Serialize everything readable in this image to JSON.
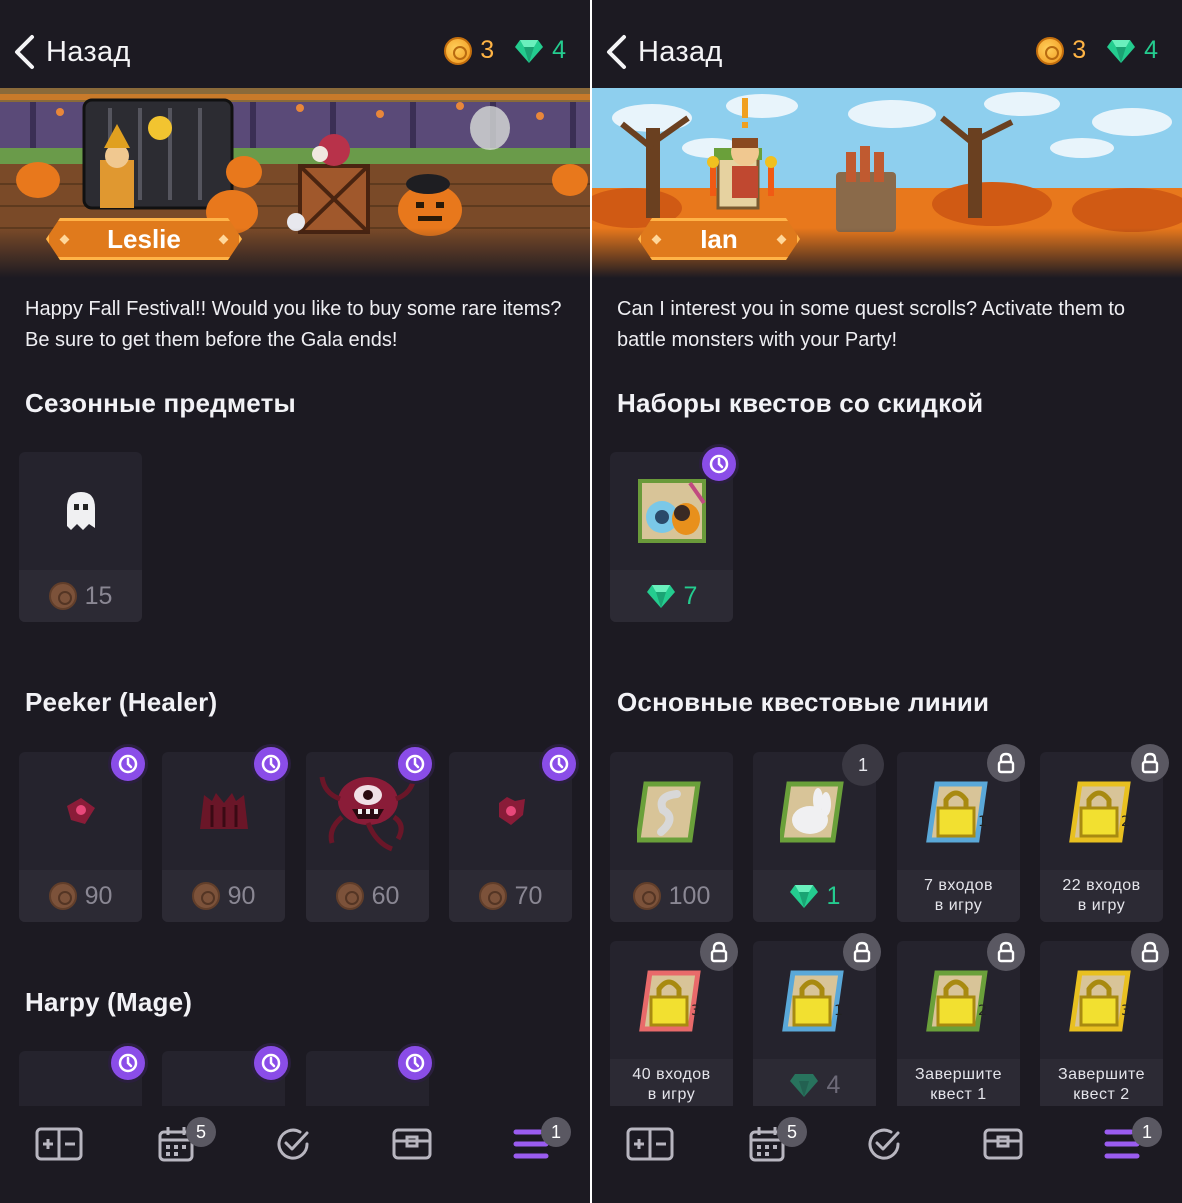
{
  "left": {
    "header": {
      "back_label": "Назад",
      "gold": "3",
      "gems": "4"
    },
    "banner": {
      "npc_name": "Leslie"
    },
    "intro": "Happy Fall Festival!! Would you like to buy some rare items? Be sure to get them before the Gala ends!",
    "sections": [
      {
        "title": "Сезонные предметы",
        "items": [
          {
            "icon": "ghost-icon",
            "price": "15",
            "currency": "gold",
            "timed": false
          }
        ]
      },
      {
        "title": "Peeker (Healer)",
        "items": [
          {
            "icon": "peeker-eye-icon",
            "price": "90",
            "currency": "gold",
            "timed": true
          },
          {
            "icon": "peeker-armor-icon",
            "price": "90",
            "currency": "gold",
            "timed": true
          },
          {
            "icon": "peeker-monster-icon",
            "price": "60",
            "currency": "gold",
            "timed": true
          },
          {
            "icon": "peeker-shield-icon",
            "price": "70",
            "currency": "gold",
            "timed": true
          }
        ]
      },
      {
        "title": "Harpy (Mage)",
        "items": [
          {
            "icon": "harpy-wings-icon",
            "timed": true
          },
          {
            "icon": "harpy-legs-icon",
            "timed": true
          },
          {
            "icon": "harpy-hat-icon",
            "timed": true
          }
        ]
      }
    ]
  },
  "right": {
    "header": {
      "back_label": "Назад",
      "gold": "3",
      "gems": "4"
    },
    "banner": {
      "npc_name": "Ian"
    },
    "intro": "Can I interest you in some quest scrolls? Activate them to battle monsters with your Party!",
    "sections": [
      {
        "title": "Наборы квестов со скидкой",
        "items": [
          {
            "icon": "quest-bundle-icon",
            "price": "7",
            "currency": "gem",
            "timed": true
          }
        ]
      },
      {
        "title": "Основные квестовые линии",
        "items": [
          {
            "icon": "quest-scroll-snake-icon",
            "price": "100",
            "currency": "gold"
          },
          {
            "icon": "quest-scroll-bunny-icon",
            "price": "1",
            "currency": "gem",
            "count": "1"
          },
          {
            "icon": "quest-scroll-locked-icon",
            "label_line1": "7 входов",
            "label_line2": "в игру",
            "locked": true
          },
          {
            "icon": "quest-scroll-locked-icon",
            "label_line1": "22 входов",
            "label_line2": "в игру",
            "locked": true
          },
          {
            "icon": "quest-scroll-locked-icon",
            "label_line1": "40 входов",
            "label_line2": "в игру",
            "locked": true
          },
          {
            "icon": "quest-scroll-locked-icon",
            "price": "4",
            "currency": "gem",
            "locked": true
          },
          {
            "icon": "quest-scroll-locked-icon",
            "label_line1": "Завершите",
            "label_line2": "квест 1",
            "locked": true
          },
          {
            "icon": "quest-scroll-locked-icon",
            "label_line1": "Завершите",
            "label_line2": "квест 2",
            "locked": true
          }
        ]
      }
    ]
  },
  "tabbar": {
    "calendar_badge": "5",
    "menu_badge": "1"
  },
  "colors": {
    "background": "#1c1a22",
    "card": "#25232d",
    "accent_purple": "#8a4de8",
    "gold": "#ffb445",
    "gem": "#24cc8f",
    "nameplate": "#e07a1c"
  }
}
